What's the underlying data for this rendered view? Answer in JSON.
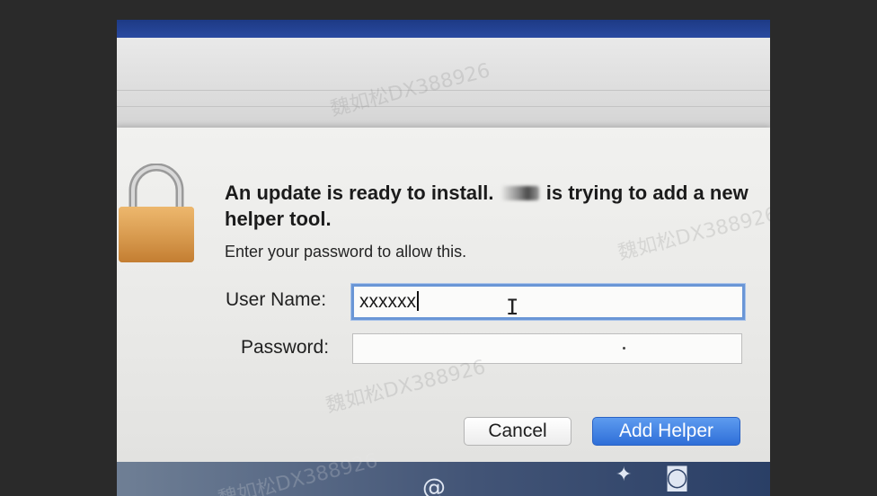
{
  "dialog": {
    "title_before": "An update is ready to install.",
    "title_after": "is trying to add a new helper tool.",
    "subtitle": "Enter your password to allow this.",
    "username_label": "User Name:",
    "username_value": "xxxxxx",
    "password_label": "Password:",
    "cancel_label": "Cancel",
    "add_helper_label": "Add Helper"
  },
  "watermark": {
    "text": "魏如松DX388926"
  },
  "colors": {
    "primary_button": "#3c7ee3",
    "focus_ring": "#6a96d6",
    "lock_body": "#e0a050"
  },
  "icons": {
    "lock": "lock-icon",
    "text_cursor": "text-cursor-icon"
  }
}
